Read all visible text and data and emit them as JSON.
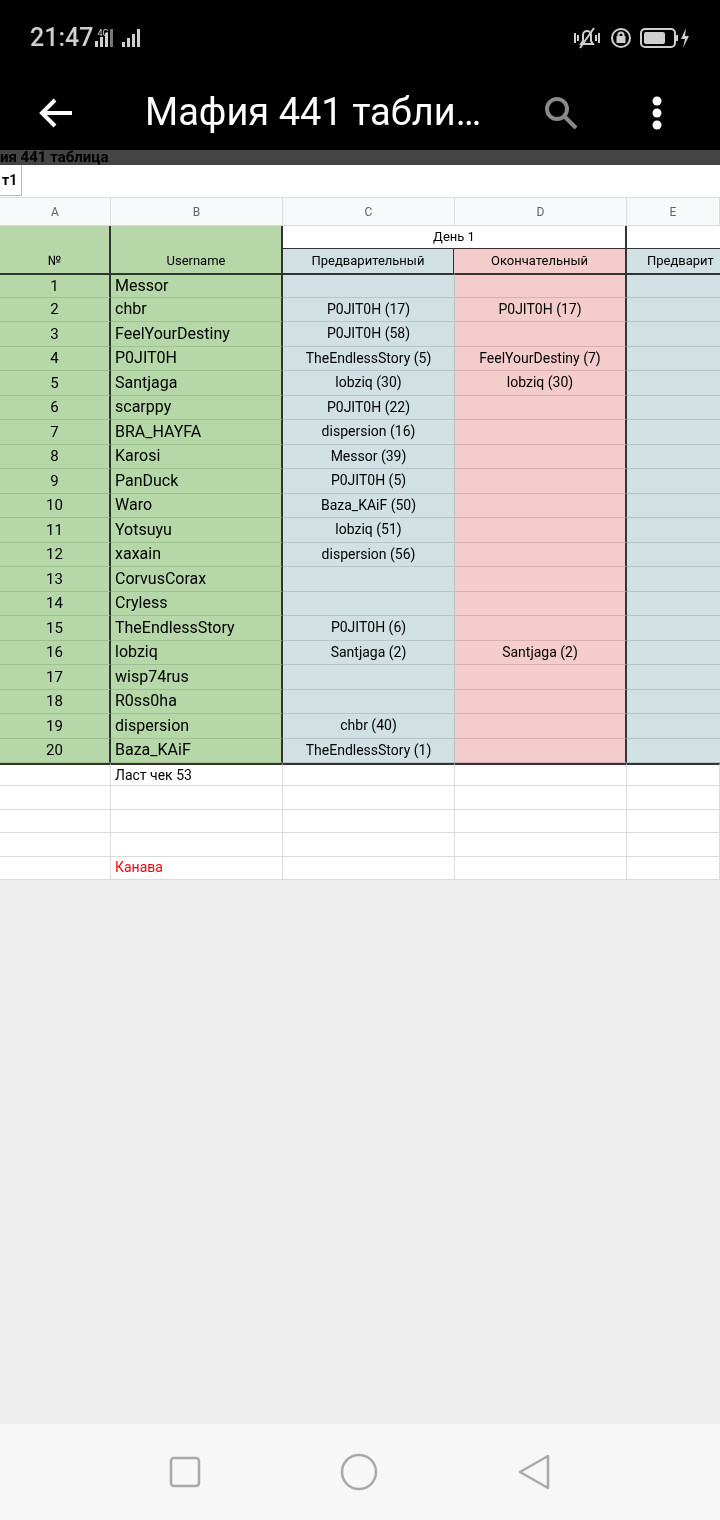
{
  "status_bar": {
    "time": "21:47",
    "network": "4G"
  },
  "app_bar": {
    "title": "Мафия 441 табли…"
  },
  "sheet_title": "ия 441 таблица",
  "sheet_tabs": [
    {
      "label": "т1",
      "selected": true
    }
  ],
  "columns": [
    "A",
    "B",
    "C",
    "D",
    "E"
  ],
  "header": {
    "number": "№",
    "username": "Username",
    "day": "День 1",
    "prelim": "Предварительный",
    "final": "Окончательный",
    "next_prelim": "Предварит"
  },
  "players": [
    {
      "n": "1",
      "name": "Messor"
    },
    {
      "n": "2",
      "name": "chbr",
      "prelim": "P0JIT0H (17)",
      "final": "P0JIT0H (17)"
    },
    {
      "n": "3",
      "name": "FeelYourDestiny",
      "prelim": "P0JIT0H (58)"
    },
    {
      "n": "4",
      "name": "P0JIT0H",
      "prelim": "TheEndlessStory (5)",
      "final": "FeelYourDestiny (7)"
    },
    {
      "n": "5",
      "name": "Santjaga",
      "prelim": "lobziq (30)",
      "final": "lobziq (30)"
    },
    {
      "n": "6",
      "name": "scarppy",
      "prelim": "P0JIT0H (22)"
    },
    {
      "n": "7",
      "name": "BRA_HAYFA",
      "prelim": "dispersion (16)"
    },
    {
      "n": "8",
      "name": "Karosi",
      "prelim": "Messor (39)"
    },
    {
      "n": "9",
      "name": "PanDuck",
      "prelim": "P0JIT0H (5)"
    },
    {
      "n": "10",
      "name": "Waro",
      "prelim": "Baza_KAiF (50)"
    },
    {
      "n": "11",
      "name": "Yotsuyu",
      "prelim": "lobziq (51)"
    },
    {
      "n": "12",
      "name": "xaxain",
      "prelim": "dispersion (56)"
    },
    {
      "n": "13",
      "name": "CorvusCorax"
    },
    {
      "n": "14",
      "name": "Cryless"
    },
    {
      "n": "15",
      "name": "TheEndlessStory",
      "prelim": "P0JIT0H (6)"
    },
    {
      "n": "16",
      "name": "lobziq",
      "prelim": "Santjaga (2)",
      "final": "Santjaga (2)"
    },
    {
      "n": "17",
      "name": "wisp74rus"
    },
    {
      "n": "18",
      "name": "R0ss0ha"
    },
    {
      "n": "19",
      "name": "dispersion",
      "prelim": "chbr (40)"
    },
    {
      "n": "20",
      "name": "Baza_KAiF",
      "prelim": "TheEndlessStory (1)"
    }
  ],
  "footer_rows": [
    {
      "kind": "note",
      "text": "Ласт чек 53"
    },
    {
      "kind": "blank"
    },
    {
      "kind": "blank"
    },
    {
      "kind": "blank"
    },
    {
      "kind": "alert",
      "text": "Канава"
    }
  ]
}
